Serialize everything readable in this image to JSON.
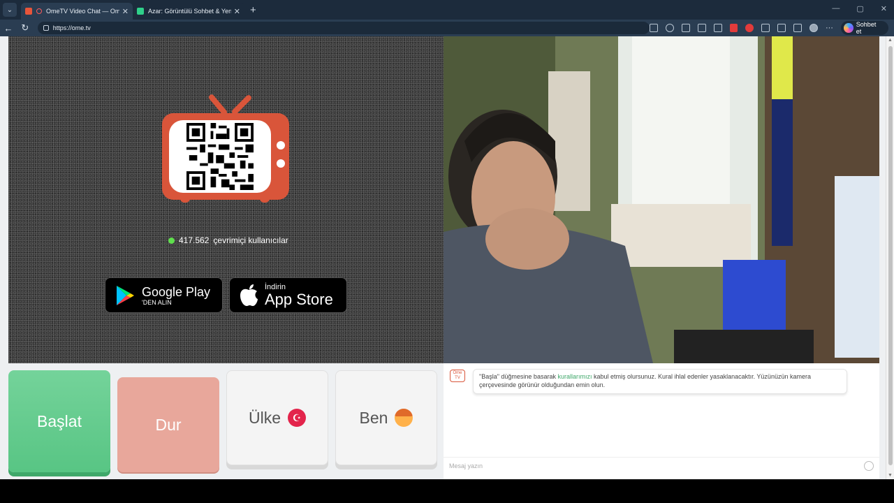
{
  "browser": {
    "tabs": [
      {
        "title": "OmeTV Video Chat — Omeg",
        "active": true
      },
      {
        "title": "Azar: Görüntülü Sohbet & Yeni İnsa",
        "active": false
      }
    ],
    "url": "https://ome.tv",
    "copilot_label": "Sohbet et"
  },
  "left_panel": {
    "online_count": "417.562",
    "online_label": "çevrimiçi kullanıcılar",
    "google_play": {
      "title": "Google Play",
      "sub": "'DEN ALIN"
    },
    "app_store": {
      "sub": "İndirin",
      "title": "App Store"
    }
  },
  "controls": {
    "start": "Başlat",
    "stop": "Dur",
    "country": "Ülke",
    "me": "Ben"
  },
  "chat": {
    "logo_text_1": "Ome",
    "logo_text_2": "TV",
    "message_part1": "\"Başla\" düğmesine basarak ",
    "message_link": "kurallarımızı",
    "message_part2": " kabul etmiş olursunuz. Kural ihlal edenler yasaklanacaktır. Yüzünüzün kamera çerçevesinde görünür olduğundan emin olun.",
    "input_placeholder": "Mesaj yazın"
  },
  "colors": {
    "accent_green": "#58c584",
    "stop_red": "#e8a79b",
    "tv_orange": "#d9553a",
    "online_dot": "#5fe04d"
  }
}
